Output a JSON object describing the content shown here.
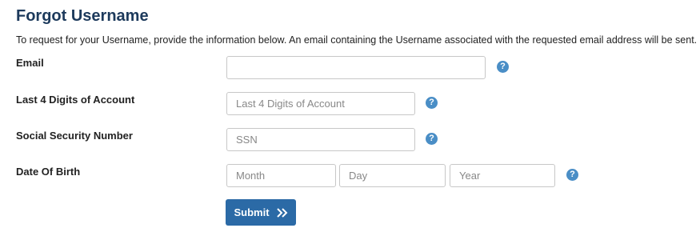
{
  "page": {
    "title": "Forgot Username",
    "intro": "To request for your Username, provide the information below. An email containing the Username associated with the requested email address will be sent."
  },
  "form": {
    "email": {
      "label": "Email",
      "placeholder": "",
      "value": ""
    },
    "account": {
      "label": "Last 4 Digits of Account",
      "placeholder": "Last 4 Digits of Account"
    },
    "ssn": {
      "label": "Social Security Number",
      "placeholder": "SSN"
    },
    "dob": {
      "label": "Date Of Birth",
      "month_placeholder": "Month",
      "day_placeholder": "Day",
      "year_placeholder": "Year"
    },
    "help_glyph": "?",
    "submit_label": "Submit"
  },
  "colors": {
    "title": "#1d3a5c",
    "accent": "#2b6aa6",
    "help_icon": "#4a8ec6",
    "field_border": "#c7c7c7"
  },
  "icons": {
    "help": "question-mark-circle-icon",
    "submit": "double-chevron-right-icon"
  }
}
